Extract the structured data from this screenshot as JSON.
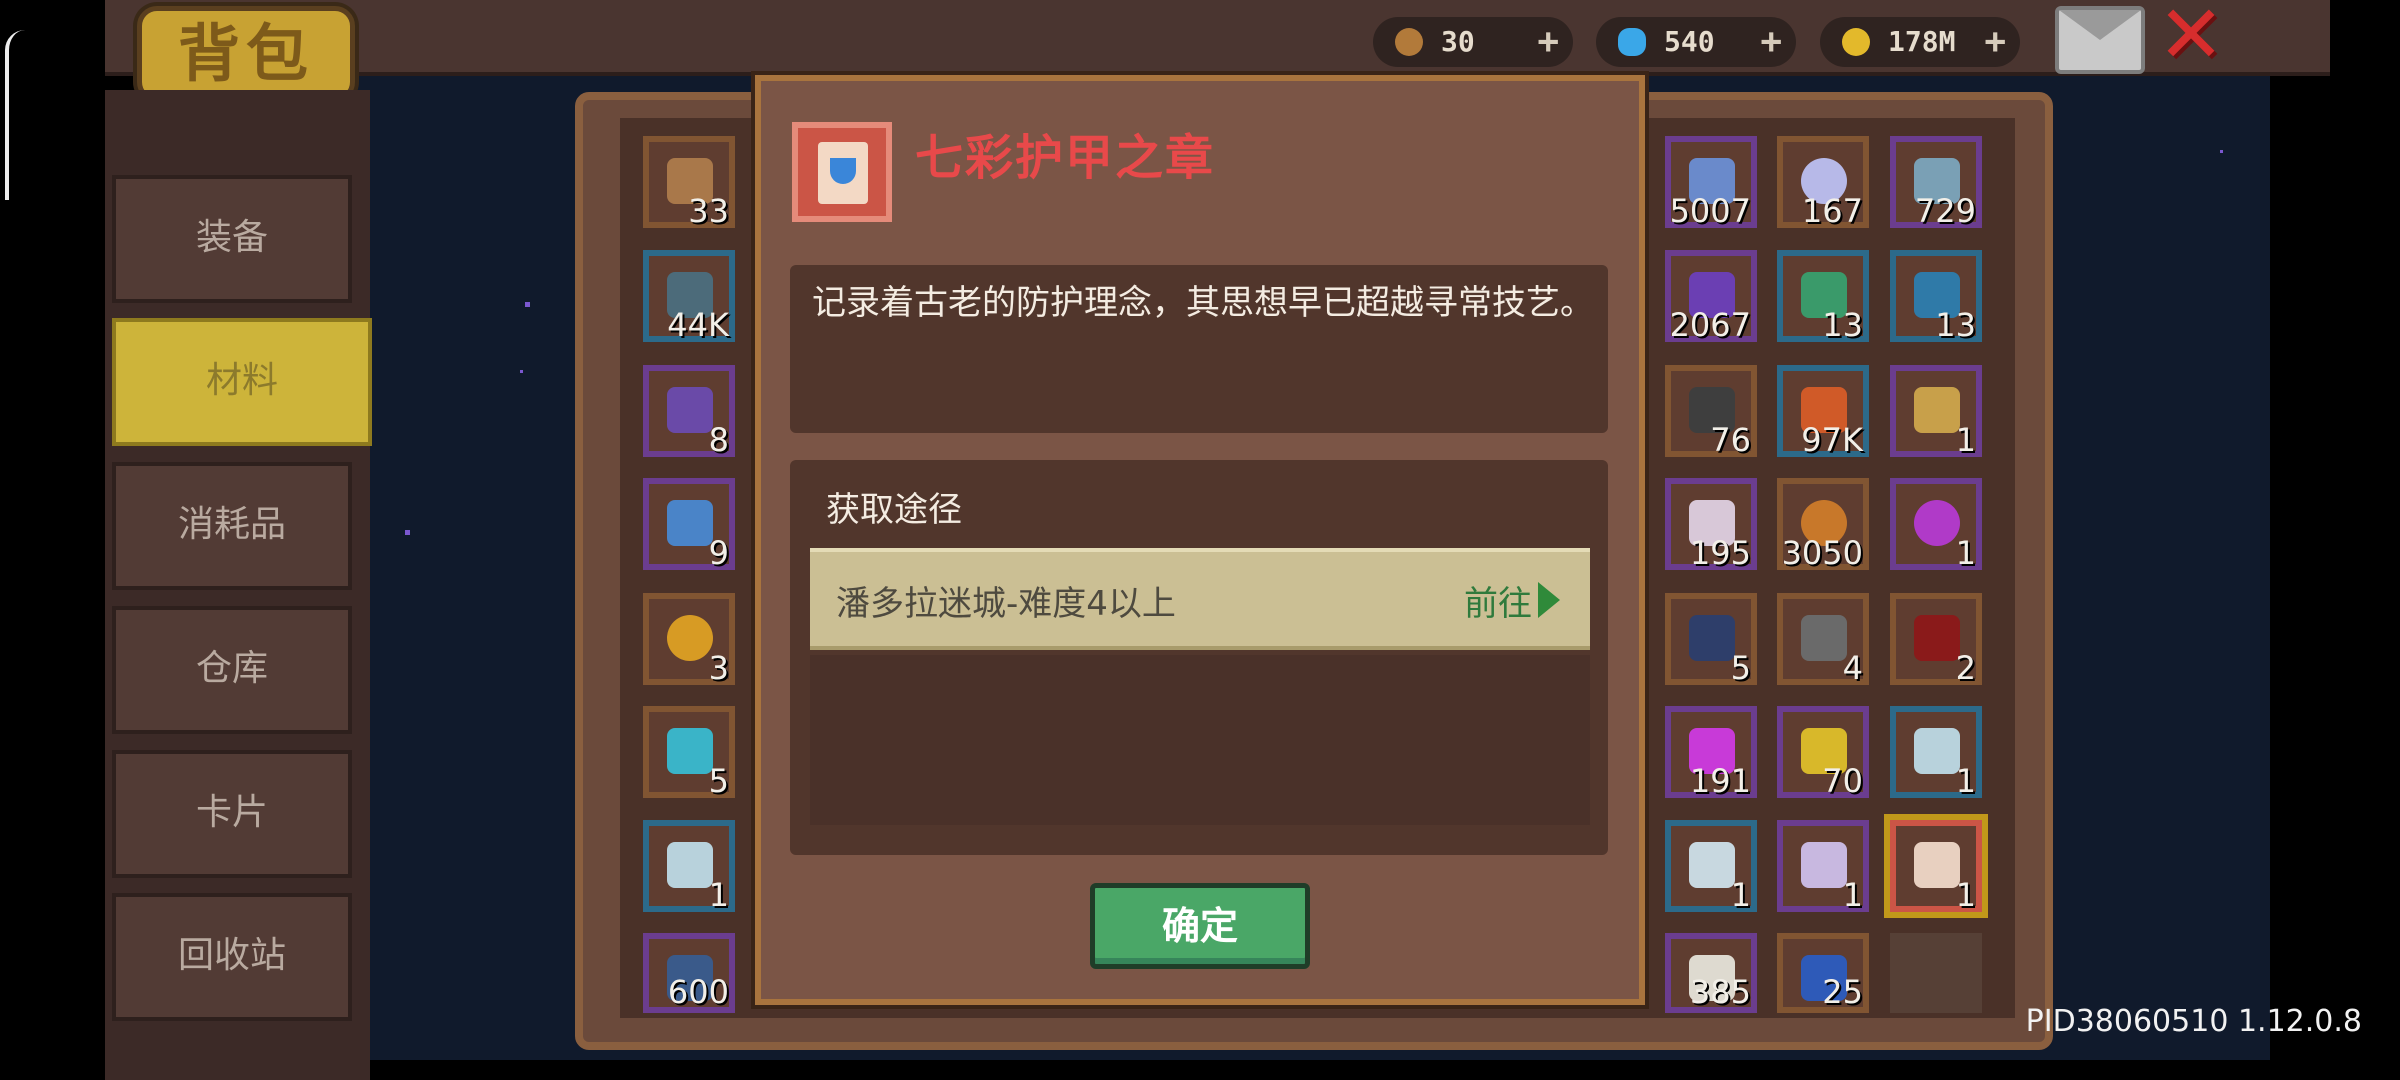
{
  "header": {
    "title": "背包",
    "resources": [
      {
        "name": "key",
        "value": "30",
        "icon": "key-icon",
        "color": "#b27a3a"
      },
      {
        "name": "gem",
        "value": "540",
        "icon": "gem-icon",
        "color": "#3aa7e8"
      },
      {
        "name": "gold",
        "value": "178M",
        "icon": "coin-icon",
        "color": "#e3b92b"
      }
    ],
    "plus_label": "+",
    "mail_icon": "mail-icon",
    "close_icon": "close-icon",
    "close_label": "✕"
  },
  "menu": {
    "tabs": [
      {
        "label": "装备",
        "active": false
      },
      {
        "label": "材料",
        "active": true
      },
      {
        "label": "消耗品",
        "active": false
      },
      {
        "label": "仓库",
        "active": false
      },
      {
        "label": "卡片",
        "active": false
      },
      {
        "label": "回收站",
        "active": false
      }
    ]
  },
  "inventory": {
    "left_column": [
      "33",
      "44K",
      "8",
      "9",
      "3",
      "5",
      "1",
      "600"
    ],
    "right_columns": [
      [
        "5007",
        "167",
        "729"
      ],
      [
        "2067",
        "13",
        "13"
      ],
      [
        "76",
        "97K",
        "1"
      ],
      [
        "195",
        "3050",
        "1"
      ],
      [
        "5",
        "4",
        "2"
      ],
      [
        "191",
        "70",
        "1"
      ],
      [
        "1",
        "1",
        "1"
      ],
      [
        "385",
        "25",
        ""
      ]
    ]
  },
  "dialog": {
    "item_name": "七彩护甲之章",
    "description": "记录着古老的防护理念，其思想早已超越寻常技艺。",
    "source_title": "获取途径",
    "sources": [
      {
        "label": "潘多拉迷城-难度4以上",
        "action": "前往"
      }
    ],
    "confirm_label": "确定"
  },
  "footer": {
    "version": "PID38060510 1.12.0.8"
  }
}
